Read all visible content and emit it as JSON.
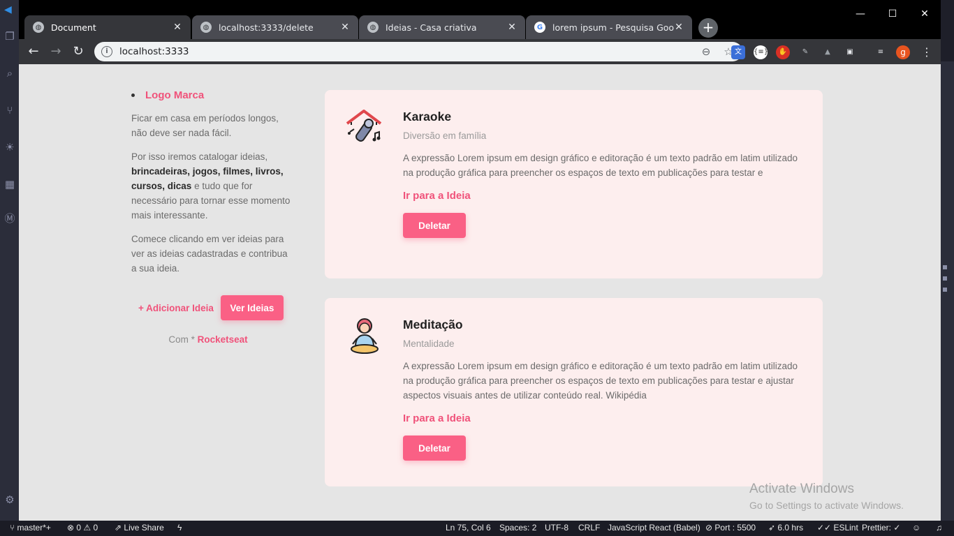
{
  "browser": {
    "tabs": [
      {
        "title": "Document",
        "favicon": "globe-icon",
        "active": true
      },
      {
        "title": "localhost:3333/delete",
        "favicon": "globe-icon",
        "active": false
      },
      {
        "title": "Ideias - Casa criativa",
        "favicon": "globe-icon",
        "active": false
      },
      {
        "title": "lorem ipsum - Pesquisa Google",
        "favicon": "google-icon",
        "active": false
      }
    ],
    "close_glyph": "✕",
    "new_tab_glyph": "+",
    "window_controls": {
      "minimize": "—",
      "maximize": "☐",
      "close": "✕"
    },
    "url": "localhost:3333",
    "profile_initial": "g"
  },
  "page": {
    "sidebar": {
      "logo": "Logo Marca",
      "para1": "Ficar em casa em períodos longos, não deve ser nada fácil.",
      "para2_prefix": "Por isso iremos catalogar ideias,",
      "para2_bold": "brincadeiras, jogos, filmes, livros, cursos, dicas",
      "para2_suffix": "e tudo que for necessário para tornar esse momento mais interessante.",
      "para3": "Comece clicando em ver ideias para ver as ideias cadastradas e contribua a sua ideia.",
      "add_link": "+ Adicionar Ideia",
      "view_button": "Ver Ideias",
      "credits_prefix": "Com *",
      "credits_brand": "Rocketseat"
    },
    "ideas": [
      {
        "title": "Karaoke",
        "category": "Diversão em família",
        "description": "A expressão Lorem ipsum em design gráfico e editoração é um texto padrão em latim utilizado na produção gráfica para preencher os espaços de texto em publicações para testar e",
        "link": "Ir para a Ideia",
        "delete": "Deletar",
        "icon": "karaoke-microphone-icon"
      },
      {
        "title": "Meditação",
        "category": "Mentalidade",
        "description": "A expressão Lorem ipsum em design gráfico e editoração é um texto padrão em latim utilizado na produção gráfica para preencher os espaços de texto em publicações para testar e ajustar aspectos visuais antes de utilizar conteúdo real. Wikipédia",
        "link": "Ir para a Ideia",
        "delete": "Deletar",
        "icon": "meditation-person-icon"
      }
    ],
    "accent_color": "#fa6085"
  },
  "watermark": {
    "line1": "Activate Windows",
    "line2": "Go to Settings to activate Windows."
  },
  "statusbar": {
    "branch": "master*+",
    "errors": "0",
    "warnings": "0",
    "live_share": "Live Share",
    "position": "Ln 75, Col 6",
    "spaces": "Spaces: 2",
    "encoding": "UTF-8",
    "eol": "CRLF",
    "language": "JavaScript React (Babel)",
    "port": "Port : 5500",
    "time": "6.0 hrs",
    "eslint": "ESLint",
    "prettier": "Prettier: ✓"
  }
}
